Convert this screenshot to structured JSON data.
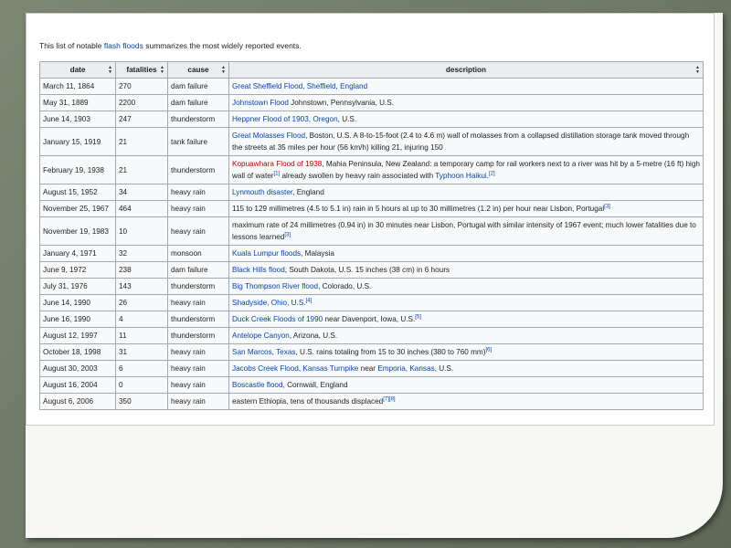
{
  "intro": {
    "before": "This list of notable ",
    "link": "flash floods",
    "after": " summarizes the most widely reported events."
  },
  "headers": [
    "date",
    "fatalities",
    "cause",
    "description"
  ],
  "rows": [
    {
      "date": "March 11, 1864",
      "fatalities": "270",
      "cause": "dam failure",
      "desc": [
        {
          "t": "Great Sheffield Flood",
          "c": "lk"
        },
        {
          "t": ", "
        },
        {
          "t": "Sheffield",
          "c": "lk"
        },
        {
          "t": ", "
        },
        {
          "t": "England",
          "c": "lk"
        }
      ]
    },
    {
      "date": "May 31, 1889",
      "fatalities": "2200",
      "cause": "dam failure",
      "desc": [
        {
          "t": "Johnstown Flood",
          "c": "lk"
        },
        {
          "t": " Johnstown, Pennsylvania, U.S."
        }
      ]
    },
    {
      "date": "June 14, 1903",
      "fatalities": "247",
      "cause": "thunderstorm",
      "desc": [
        {
          "t": "Heppner Flood of 1903",
          "c": "lk"
        },
        {
          "t": ", "
        },
        {
          "t": "Oregon",
          "c": "lk"
        },
        {
          "t": ", U.S."
        }
      ]
    },
    {
      "date": "January 15, 1919",
      "fatalities": "21",
      "cause": "tank failure",
      "desc": [
        {
          "t": "Great Molasses Flood",
          "c": "lk"
        },
        {
          "t": ", Boston, U.S. A 8-to-15-foot (2.4 to 4.6 m) wall of molasses from a collapsed distillation storage tank moved through the streets at 35 miles per hour (56 km/h) killing 21, injuring 150"
        }
      ]
    },
    {
      "date": "February 19, 1938",
      "fatalities": "21",
      "cause": "thunderstorm",
      "desc": [
        {
          "t": "Kopuawhara Flood of 1938",
          "c": "rl"
        },
        {
          "t": ", Mahia Peninsula, New Zealand: a temporary camp for rail workers next to a river was hit by a 5-metre (16 ft) high wall of water"
        },
        {
          "t": "[1]",
          "c": "sup"
        },
        {
          "t": " already swollen by heavy rain associated with "
        },
        {
          "t": "Typhoon Haikui",
          "c": "lk"
        },
        {
          "t": "."
        },
        {
          "t": "[2]",
          "c": "sup"
        }
      ]
    },
    {
      "date": "August 15, 1952",
      "fatalities": "34",
      "cause": "heavy rain",
      "desc": [
        {
          "t": "Lynmouth disaster",
          "c": "lk"
        },
        {
          "t": ", England"
        }
      ]
    },
    {
      "date": "November 25, 1967",
      "fatalities": "464",
      "cause": "heavy rain",
      "desc": [
        {
          "t": "115 to 129 millimetres (4.5 to 5.1 in) rain in 5 hours at up to 30 millimetres (1.2 in) per hour near Lisbon, Portugal"
        },
        {
          "t": "[3]",
          "c": "sup"
        }
      ]
    },
    {
      "date": "November 19, 1983",
      "fatalities": "10",
      "cause": "heavy rain",
      "desc": [
        {
          "t": "maximum rate of 24 millimetres (0.94 in) in 30 minutes near Lisbon, Portugal with similar intensity of 1967 event; much lower fatalities due to lessons learned"
        },
        {
          "t": "[3]",
          "c": "sup"
        }
      ]
    },
    {
      "date": "January 4, 1971",
      "fatalities": "32",
      "cause": "monsoon",
      "desc": [
        {
          "t": "Kuala Lumpur floods",
          "c": "lk"
        },
        {
          "t": ", Malaysia"
        }
      ]
    },
    {
      "date": "June 9, 1972",
      "fatalities": "238",
      "cause": "dam failure",
      "desc": [
        {
          "t": "Black Hills flood",
          "c": "lk"
        },
        {
          "t": ", South Dakota, U.S. 15 inches (38 cm) in 6 hours"
        }
      ]
    },
    {
      "date": "July 31, 1976",
      "fatalities": "143",
      "cause": "thunderstorm",
      "desc": [
        {
          "t": "Big Thompson River flood",
          "c": "lk"
        },
        {
          "t": ", Colorado, U.S."
        }
      ]
    },
    {
      "date": "June 14, 1990",
      "fatalities": "26",
      "cause": "heavy rain",
      "desc": [
        {
          "t": "Shadyside, Ohio, U.S.",
          "c": "lk"
        },
        {
          "t": "[4]",
          "c": "sup"
        }
      ]
    },
    {
      "date": "June 16, 1990",
      "fatalities": "4",
      "cause": "thunderstorm",
      "desc": [
        {
          "t": "Duck Creek Floods of 1990",
          "c": "lk"
        },
        {
          "t": " near Davenport, Iowa, U.S."
        },
        {
          "t": "[5]",
          "c": "sup"
        }
      ]
    },
    {
      "date": "August 12, 1997",
      "fatalities": "11",
      "cause": "thunderstorm",
      "desc": [
        {
          "t": "Antelope Canyon",
          "c": "lk"
        },
        {
          "t": ", Arizona, U.S."
        }
      ]
    },
    {
      "date": "October 18, 1998",
      "fatalities": "31",
      "cause": "heavy rain",
      "desc": [
        {
          "t": "San Marcos, Texas",
          "c": "lk"
        },
        {
          "t": ", U.S. rains totaling from 15 to 30 inches (380 to 760 mm)"
        },
        {
          "t": "[6]",
          "c": "sup"
        }
      ]
    },
    {
      "date": "August 30, 2003",
      "fatalities": "6",
      "cause": "heavy rain",
      "desc": [
        {
          "t": "Jacobs Creek Flood",
          "c": "lk"
        },
        {
          "t": ", "
        },
        {
          "t": "Kansas Turnpike",
          "c": "lk"
        },
        {
          "t": " near "
        },
        {
          "t": "Emporia, Kansas",
          "c": "lk"
        },
        {
          "t": ", U.S."
        }
      ]
    },
    {
      "date": "August 16, 2004",
      "fatalities": "0",
      "cause": "heavy rain",
      "desc": [
        {
          "t": "Boscastle flood",
          "c": "lk"
        },
        {
          "t": ", Cornwall, England"
        }
      ]
    },
    {
      "date": "August 6, 2006",
      "fatalities": "350",
      "cause": "heavy rain",
      "desc": [
        {
          "t": "eastern Ethiopia, tens of thousands displaced"
        },
        {
          "t": "[7][8]",
          "c": "sup"
        }
      ]
    }
  ],
  "colors": {
    "link": "#0645ad",
    "redlink": "#ba0000",
    "header_bg": "#eaecf0",
    "border": "#a2a9b1"
  }
}
